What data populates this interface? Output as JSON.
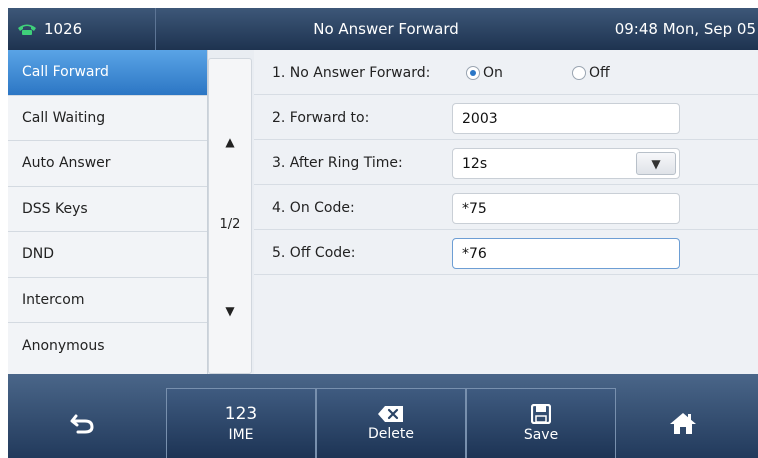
{
  "statusbar": {
    "account": "1026",
    "account_icon": "phone-icon",
    "title": "No Answer Forward",
    "clock": "09:48 Mon, Sep 05"
  },
  "sidebar": {
    "items": [
      {
        "label": "Call Forward",
        "active": true
      },
      {
        "label": "Call Waiting",
        "active": false
      },
      {
        "label": "Auto Answer",
        "active": false
      },
      {
        "label": "DSS Keys",
        "active": false
      },
      {
        "label": "DND",
        "active": false
      },
      {
        "label": "Intercom",
        "active": false
      },
      {
        "label": "Anonymous",
        "active": false
      }
    ]
  },
  "pager": {
    "indicator": "1/2",
    "up_glyph": "▲",
    "down_glyph": "▼"
  },
  "form": {
    "no_answer_forward": {
      "label": "1. No Answer Forward:",
      "on_label": "On",
      "off_label": "Off",
      "selected": "On"
    },
    "forward_to": {
      "label": "2. Forward to:",
      "value": "2003"
    },
    "after_ring_time": {
      "label": "3. After Ring Time:",
      "value": "12s",
      "dropdown_glyph": "▼"
    },
    "on_code": {
      "label": "4. On Code:",
      "value": "*75"
    },
    "off_code": {
      "label": "5. Off Code:",
      "value": "*76"
    }
  },
  "softkeys": {
    "back_glyph": "⮌",
    "ime_top": "123",
    "ime_label": "IME",
    "delete_glyph": "⌫",
    "delete_label": "Delete",
    "save_glyph": "🖫",
    "save_label": "Save",
    "home_glyph": "⌂"
  },
  "colors": {
    "accent": "#2c76c4",
    "statusbar": "#1e3350",
    "softbar": "#223a5c"
  }
}
